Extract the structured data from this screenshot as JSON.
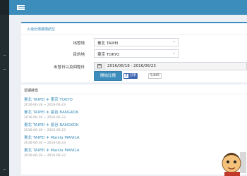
{
  "topbar": {
    "menu_icon": "hamburger-icon"
  },
  "form": {
    "title": "火速比價廉價航空",
    "origin": {
      "label": "出發地",
      "value": "臺北 TAIPEI"
    },
    "destination": {
      "label": "目的地",
      "value": "東京 TOKYO"
    },
    "dates": {
      "label": "出發日以及回程日",
      "value": "2016/06/18 - 2016/06/23"
    },
    "search_button": "開始比價",
    "share": {
      "label": "分享",
      "count": "5,845"
    }
  },
  "recent": {
    "title": "近期搜尋",
    "items": [
      {
        "route": "臺北 TAIPEI ✈ 東京 TOKYO",
        "dates": "2016-06-18 ~ 2016-06-23"
      },
      {
        "route": "臺北 TAIPEI ✈ 曼谷 BANGKOK",
        "dates": "2016-06-18 ~ 2016-06-23"
      },
      {
        "route": "臺北 TAIPEI ✈ 曼谷 BANGKOK",
        "dates": "2016-06-18 ~ 2016-06-23"
      },
      {
        "route": "臺北 TAIPEI ✈ Manila MANILA",
        "dates": "2016-06-18 ~ 2016-06-23"
      },
      {
        "route": "臺北 TAIPEI ✈ Manila MANILA",
        "dates": "2016-06-18 ~ 2016-06-23"
      }
    ]
  },
  "colors": {
    "accent": "#3c8dbc",
    "sidebar": "#222d32",
    "background": "#ecf0f5"
  }
}
